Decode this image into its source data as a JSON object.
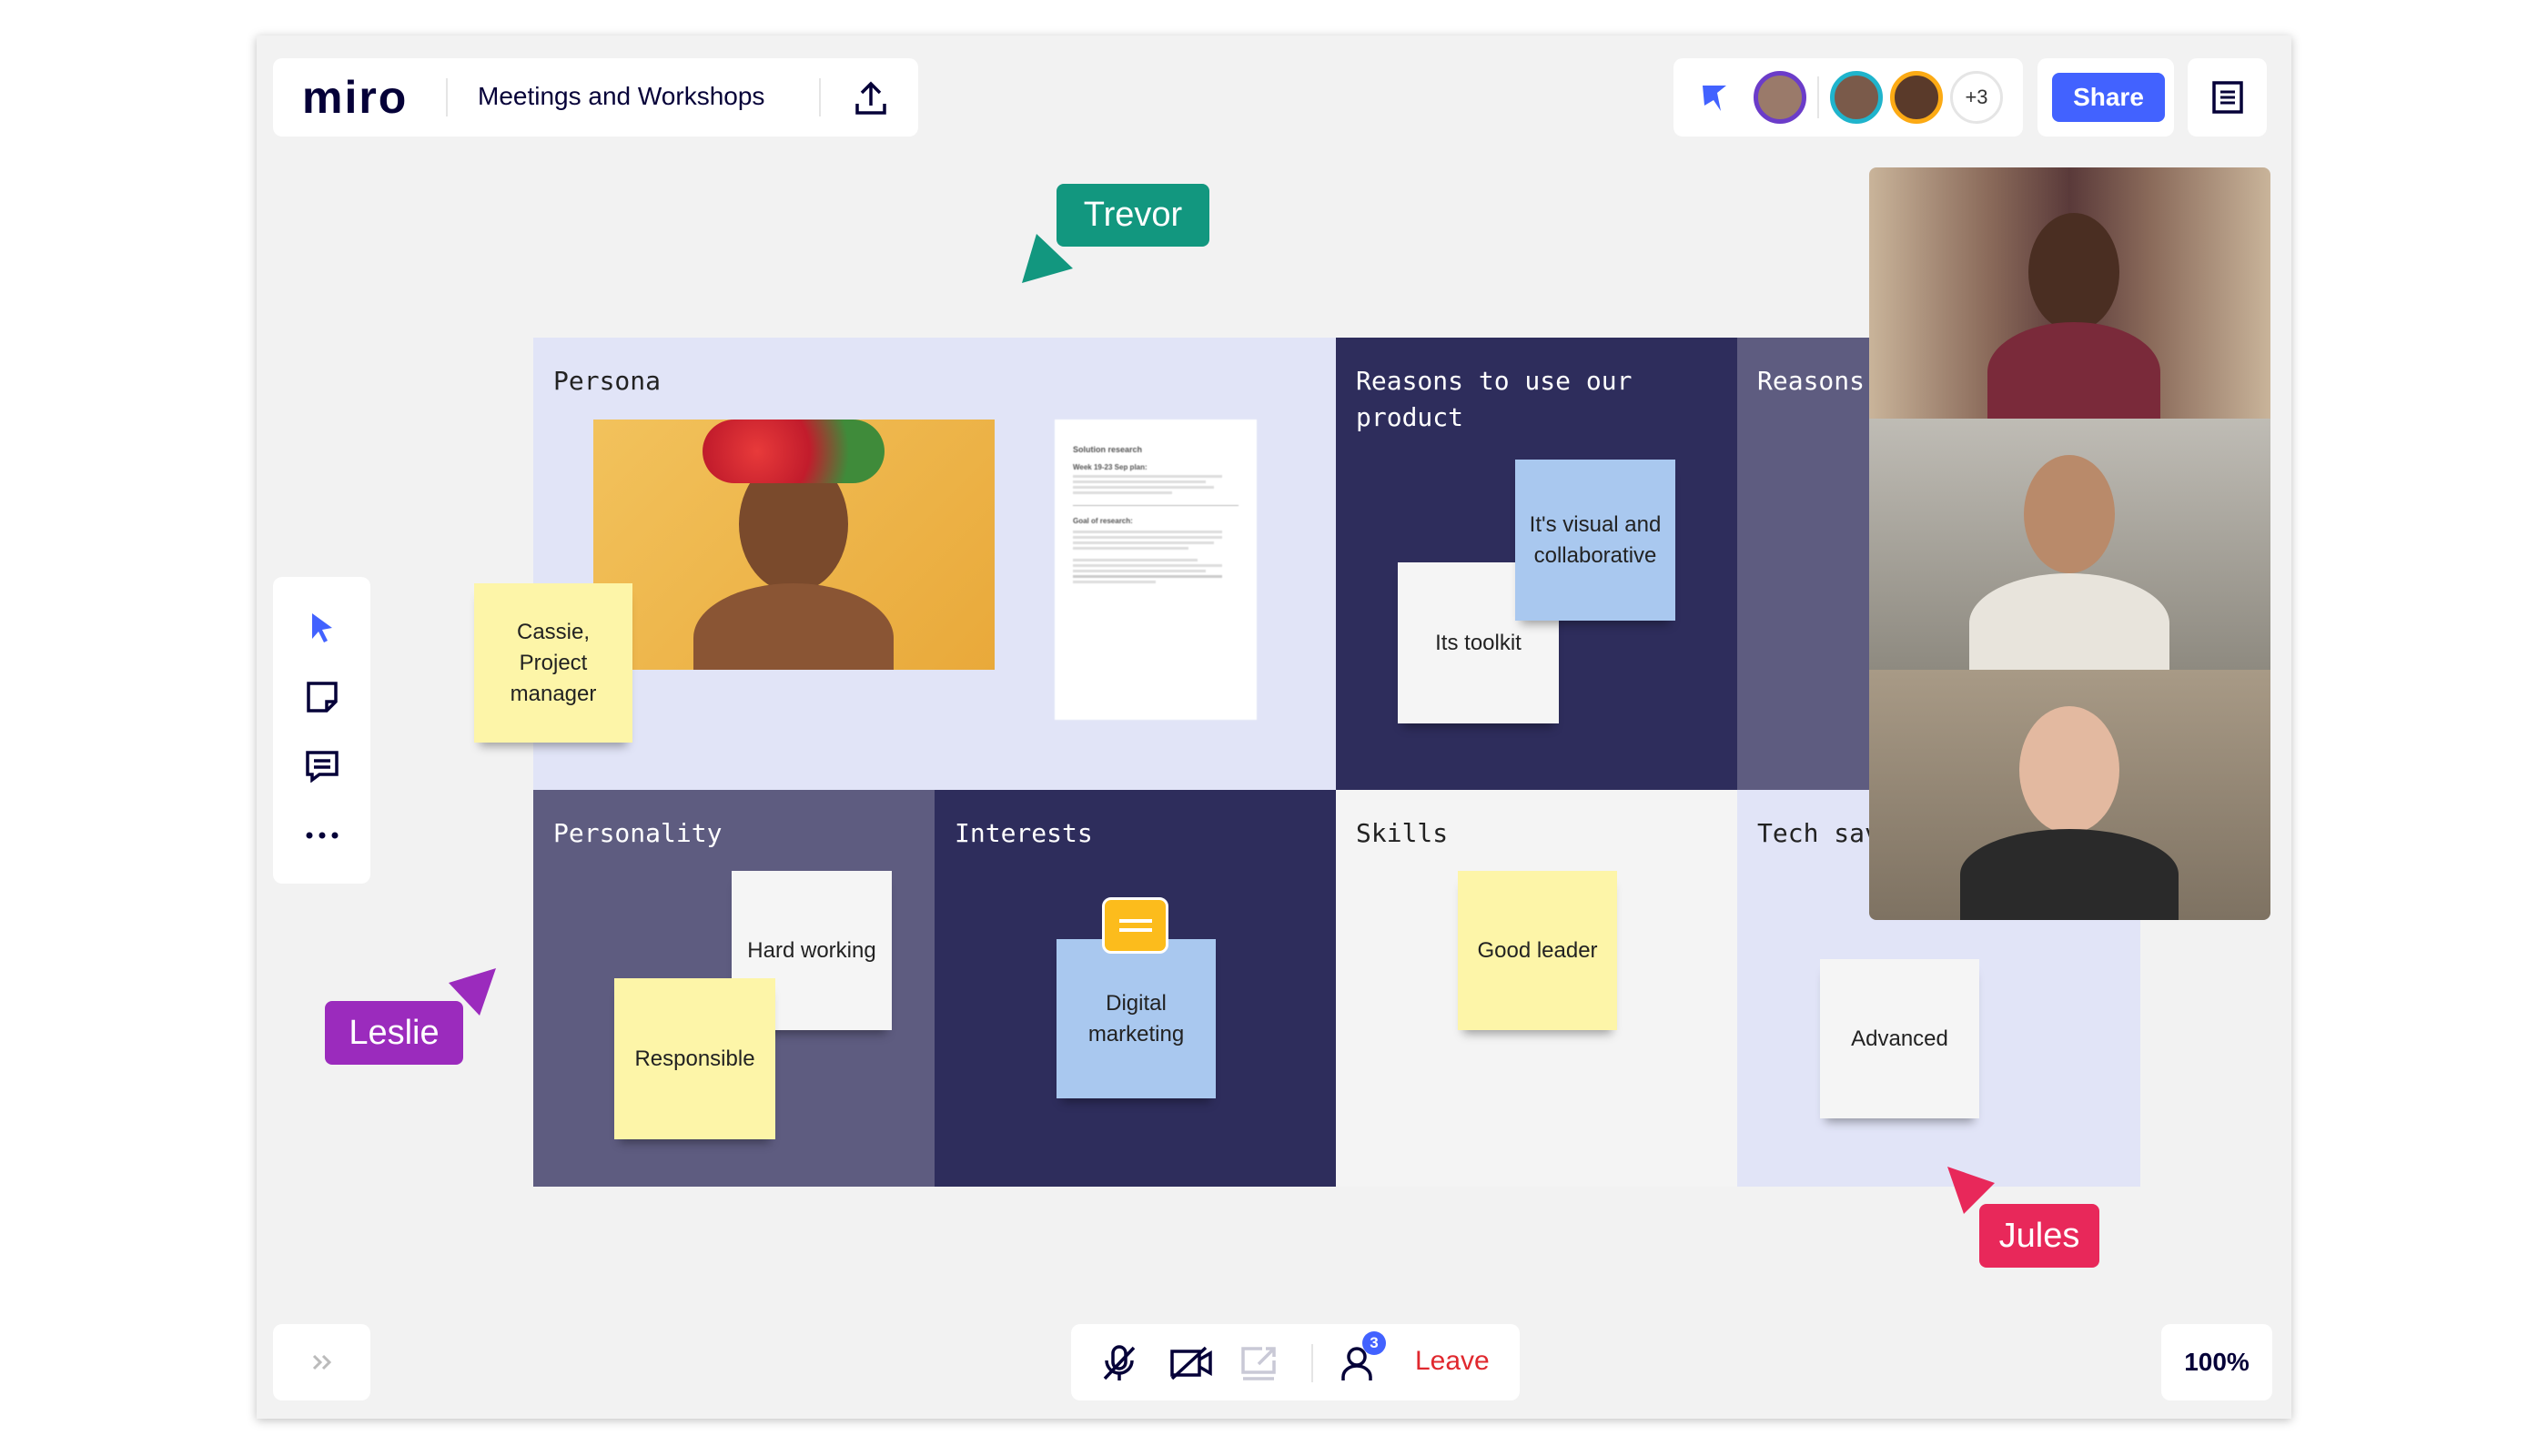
{
  "header": {
    "logo": "miro",
    "board_title": "Meetings and Workshops",
    "extra_collaborators": "+3",
    "share_label": "Share"
  },
  "cells": [
    {
      "title": "Persona",
      "color": "#e1e4f7"
    },
    {
      "title": "Reasons to use our product",
      "color": "#2e2d5c"
    },
    {
      "title": "Reasons to use our product",
      "color": "#5e5c80"
    },
    {
      "title": "Personality",
      "color": "#5e5c80"
    },
    {
      "title": "Interests",
      "color": "#2e2d5c"
    },
    {
      "title": "Skills",
      "color": "#f4f4f4"
    },
    {
      "title": "Tech savvy",
      "color": "#e1e4f7"
    }
  ],
  "stickies": {
    "cassie": "Cassie, Project manager",
    "toolkit": "Its toolkit",
    "visual": "It's visual and collaborative",
    "hard_working": "Hard working",
    "responsible": "Responsible",
    "digital": "Digital marketing",
    "good_leader": "Good leader",
    "advanced": "Advanced"
  },
  "document": {
    "title": "Solution research",
    "subtitle": "Week 19-23 Sep plan:",
    "section": "Goal of research:"
  },
  "cursors": [
    {
      "name": "Trevor",
      "color": "#12977f"
    },
    {
      "name": "Leslie",
      "color": "#9b2bbd"
    },
    {
      "name": "Jules",
      "color": "#e8285a"
    }
  ],
  "call": {
    "participants_count": "3",
    "leave_label": "Leave"
  },
  "zoom_level": "100%",
  "colors": {
    "accent": "#4262ff",
    "leave": "#e0282e"
  }
}
